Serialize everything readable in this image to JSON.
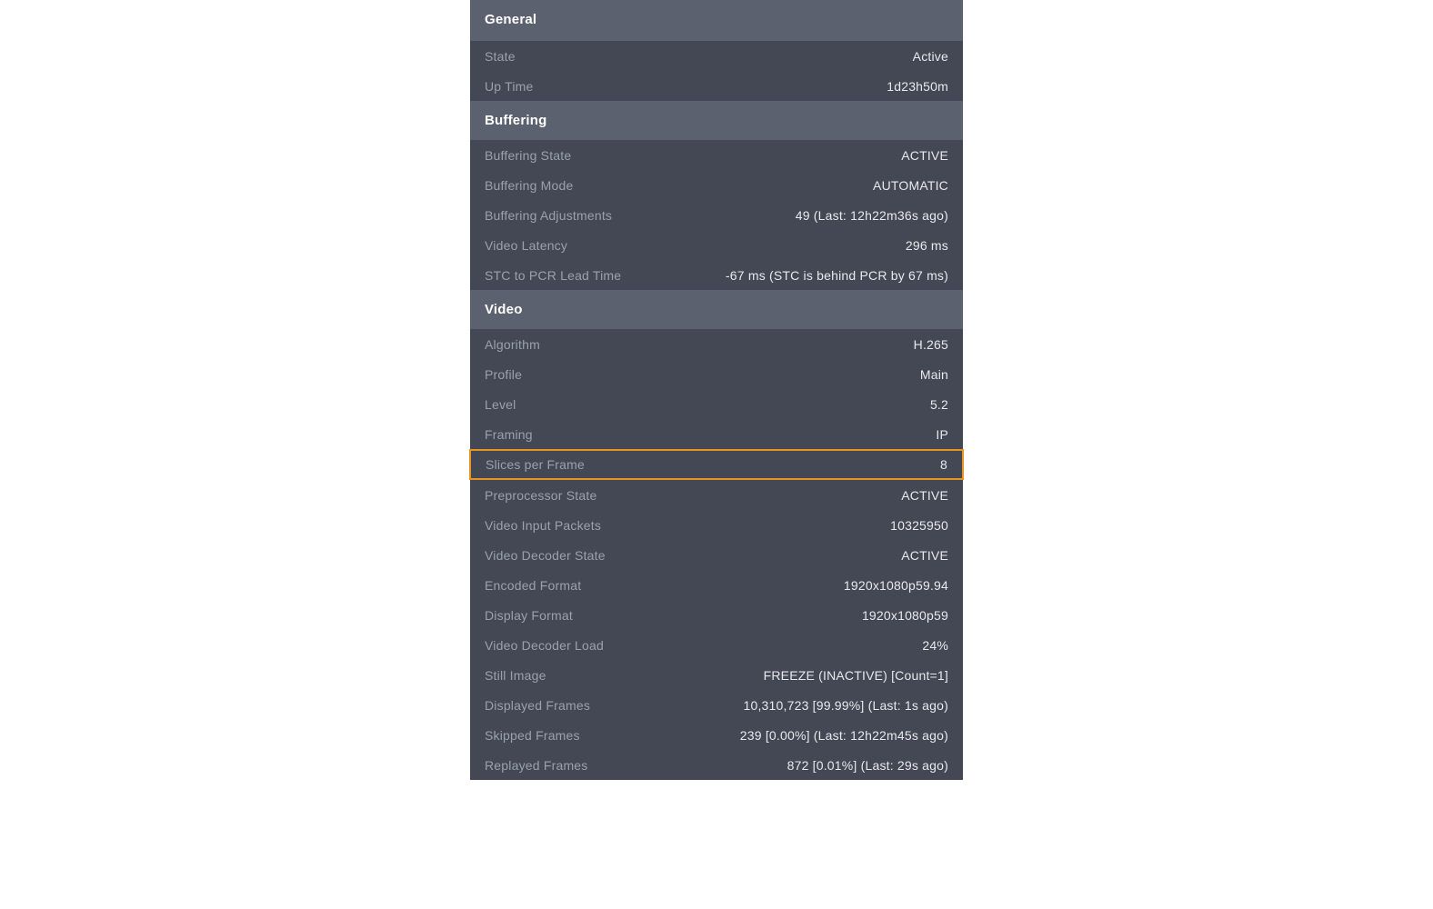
{
  "sections": {
    "general": {
      "title": "General",
      "rows": [
        {
          "label": "State",
          "value": "Active"
        },
        {
          "label": "Up Time",
          "value": "1d23h50m"
        }
      ]
    },
    "buffering": {
      "title": "Buffering",
      "rows": [
        {
          "label": "Buffering State",
          "value": "ACTIVE"
        },
        {
          "label": "Buffering Mode",
          "value": "AUTOMATIC"
        },
        {
          "label": "Buffering Adjustments",
          "value": "49 (Last: 12h22m36s ago)"
        },
        {
          "label": "Video Latency",
          "value": "296 ms"
        },
        {
          "label": "STC to PCR Lead Time",
          "value": "-67 ms (STC is behind PCR by 67 ms)"
        }
      ]
    },
    "video": {
      "title": "Video",
      "rows": [
        {
          "label": "Algorithm",
          "value": "H.265"
        },
        {
          "label": "Profile",
          "value": "Main"
        },
        {
          "label": "Level",
          "value": "5.2"
        },
        {
          "label": "Framing",
          "value": "IP"
        },
        {
          "label": "Slices per Frame",
          "value": "8"
        },
        {
          "label": "Preprocessor State",
          "value": "ACTIVE"
        },
        {
          "label": "Video Input Packets",
          "value": "10325950"
        },
        {
          "label": "Video Decoder State",
          "value": "ACTIVE"
        },
        {
          "label": "Encoded Format",
          "value": "1920x1080p59.94"
        },
        {
          "label": "Display Format",
          "value": "1920x1080p59"
        },
        {
          "label": "Video Decoder Load",
          "value": "24%"
        },
        {
          "label": "Still Image",
          "value": "FREEZE (INACTIVE) [Count=1]"
        },
        {
          "label": "Displayed Frames",
          "value": "10,310,723 [99.99%] (Last: 1s ago)"
        },
        {
          "label": "Skipped Frames",
          "value": "239 [0.00%] (Last: 12h22m45s ago)"
        },
        {
          "label": "Replayed Frames",
          "value": "872 [0.01%] (Last: 29s ago)"
        }
      ]
    }
  },
  "highlight": {
    "section": "video",
    "rowIndex": 4,
    "color": "#e6941e"
  }
}
